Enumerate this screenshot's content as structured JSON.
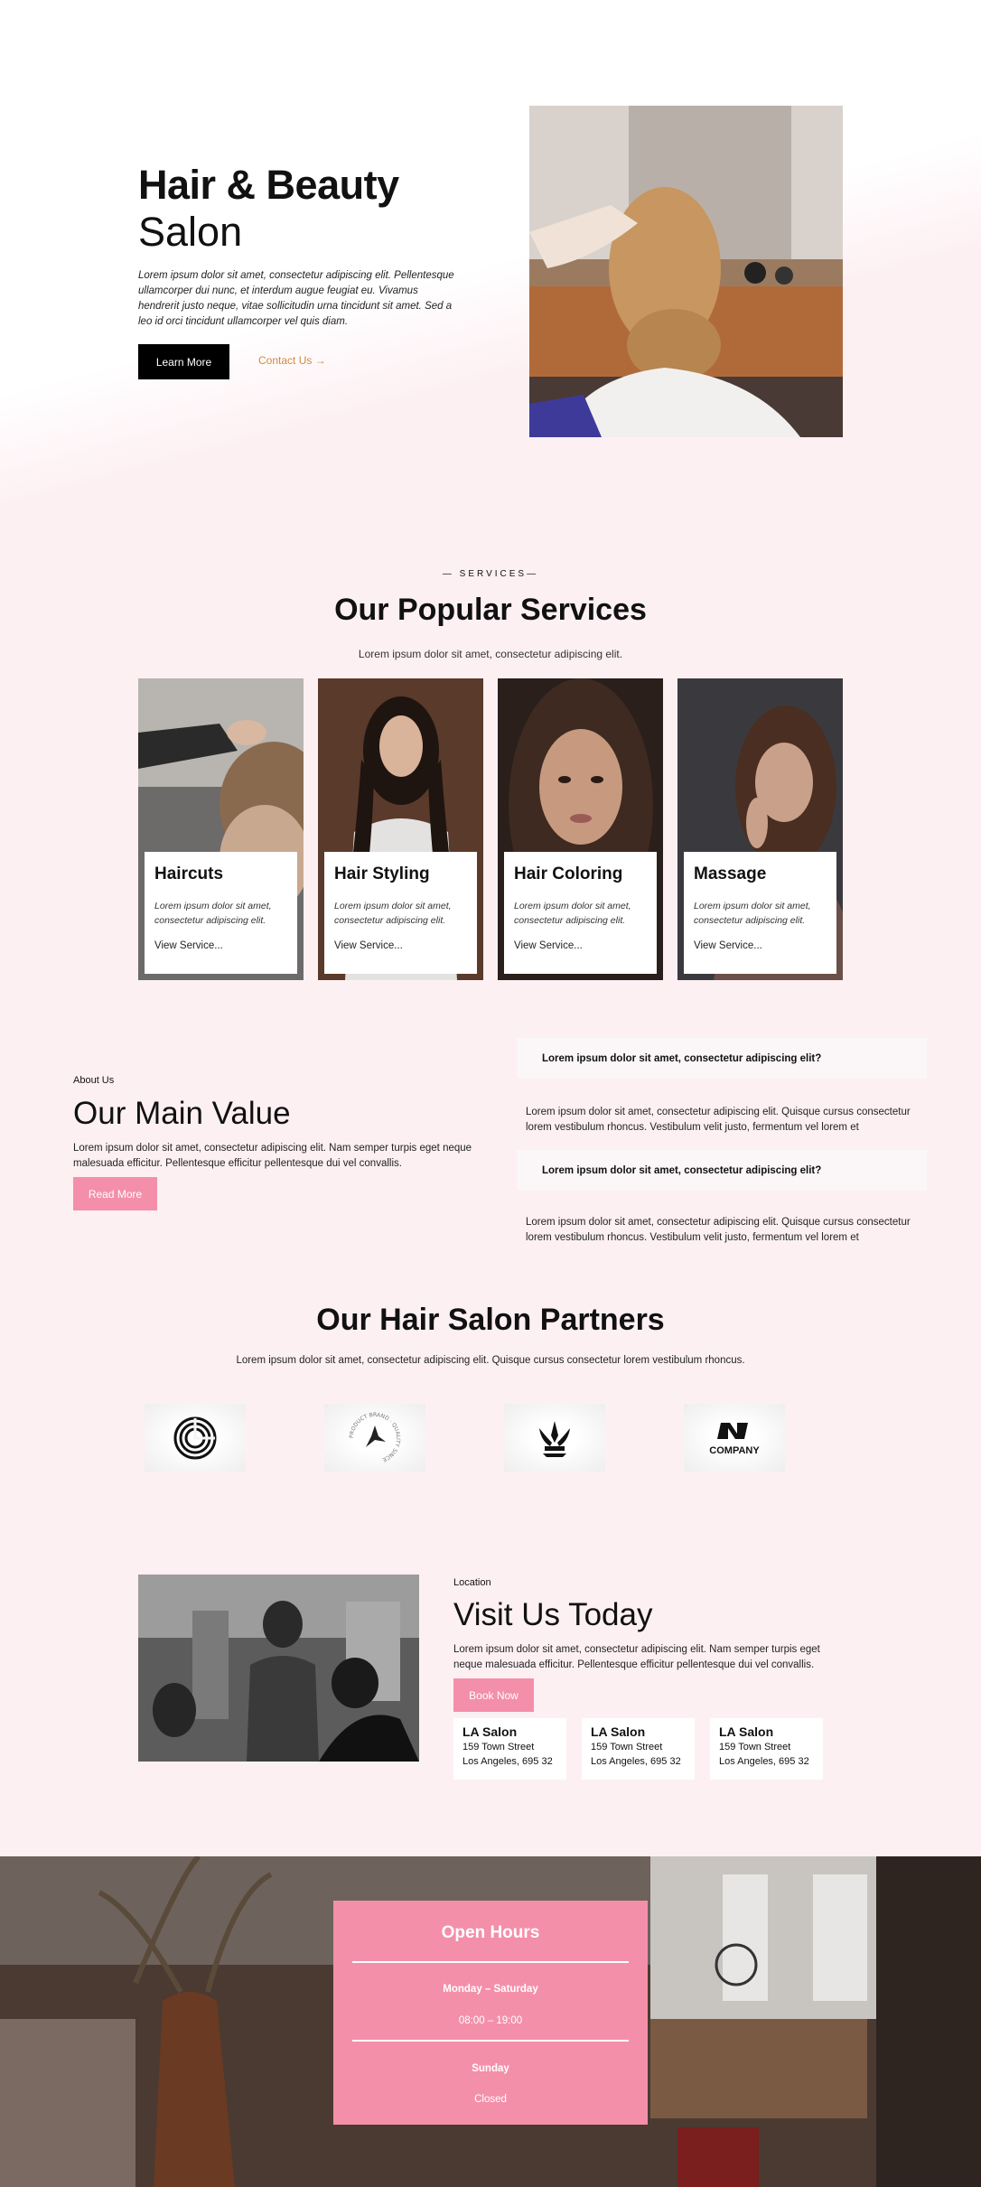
{
  "hero": {
    "title": "Hair & Beauty",
    "subtitle": "Salon",
    "text": "Lorem ipsum dolor sit amet, consectetur adipiscing elit. Pellentesque ullamcorper dui nunc, et interdum augue feugiat eu. Vivamus hendrerit justo neque, vitae sollicitudin urna tincidunt sit amet. Sed a leo id orci tincidunt ullamcorper vel quis diam.",
    "learn_more": "Learn More",
    "contact": "Contact Us →"
  },
  "services": {
    "eyebrow": "— SERVICES—",
    "title": "Our Popular Services",
    "text": "Lorem ipsum dolor sit amet, consectetur adipiscing elit.",
    "cards": [
      {
        "title": "Haircuts",
        "desc": "Lorem ipsum dolor sit amet, consectetur adipiscing elit.",
        "link": "View Service..."
      },
      {
        "title": "Hair Styling",
        "desc": "Lorem ipsum dolor sit amet, consectetur adipiscing elit.",
        "link": "View Service..."
      },
      {
        "title": "Hair Coloring",
        "desc": "Lorem ipsum dolor sit amet, consectetur adipiscing elit.",
        "link": "View Service..."
      },
      {
        "title": "Massage",
        "desc": "Lorem ipsum dolor sit amet, consectetur adipiscing elit.",
        "link": "View Service..."
      }
    ]
  },
  "about": {
    "eyebrow": "About Us",
    "title": "Our Main Value",
    "text": "Lorem ipsum dolor sit amet, consectetur adipiscing elit. Nam semper turpis eget neque malesuada efficitur. Pellentesque efficitur pellentesque dui vel convallis.",
    "button": "Read More",
    "faq": [
      {
        "q": "Lorem ipsum dolor sit amet, consectetur adipiscing elit?",
        "a": "Lorem ipsum dolor sit amet, consectetur adipiscing elit. Quisque cursus consectetur lorem vestibulum rhoncus. Vestibulum velit justo, fermentum vel lorem et"
      },
      {
        "q": "Lorem ipsum dolor sit amet, consectetur adipiscing elit?",
        "a": "Lorem ipsum dolor sit amet, consectetur adipiscing elit. Quisque cursus consectetur lorem vestibulum rhoncus. Vestibulum velit justo, fermentum vel lorem et"
      }
    ]
  },
  "partners": {
    "title": "Our Hair Salon Partners",
    "text": "Lorem ipsum dolor sit amet, consectetur adipiscing elit. Quisque cursus consectetur lorem vestibulum rhoncus.",
    "logos": [
      "spiral-logo",
      "circular-text-logo",
      "crest-logo",
      "company-logo"
    ],
    "badge_text": "PRODUCT BRAND · QUALITY SINCE",
    "company_text": "COMPANY"
  },
  "visit": {
    "eyebrow": "Location",
    "title": "Visit Us Today",
    "text": "Lorem ipsum dolor sit amet, consectetur adipiscing elit. Nam semper turpis eget neque malesuada efficitur. Pellentesque efficitur pellentesque dui vel convallis.",
    "button": "Book Now",
    "locations": [
      {
        "name": "LA Salon",
        "street": "159 Town Street",
        "city": "Los Angeles, 695 32"
      },
      {
        "name": "LA Salon",
        "street": "159 Town Street",
        "city": "Los Angeles, 695 32"
      },
      {
        "name": "LA Salon",
        "street": "159 Town Street",
        "city": "Los Angeles, 695 32"
      }
    ]
  },
  "hours": {
    "title": "Open Hours",
    "weekday_label": "Monday – Saturday",
    "weekday_time": "08:00 – 19:00",
    "sunday_label": "Sunday",
    "sunday_status": "Closed"
  },
  "colors": {
    "accent_pink": "#f48fa9",
    "contact_link": "#d38a3f",
    "page_bg": "#fdf0f3"
  }
}
